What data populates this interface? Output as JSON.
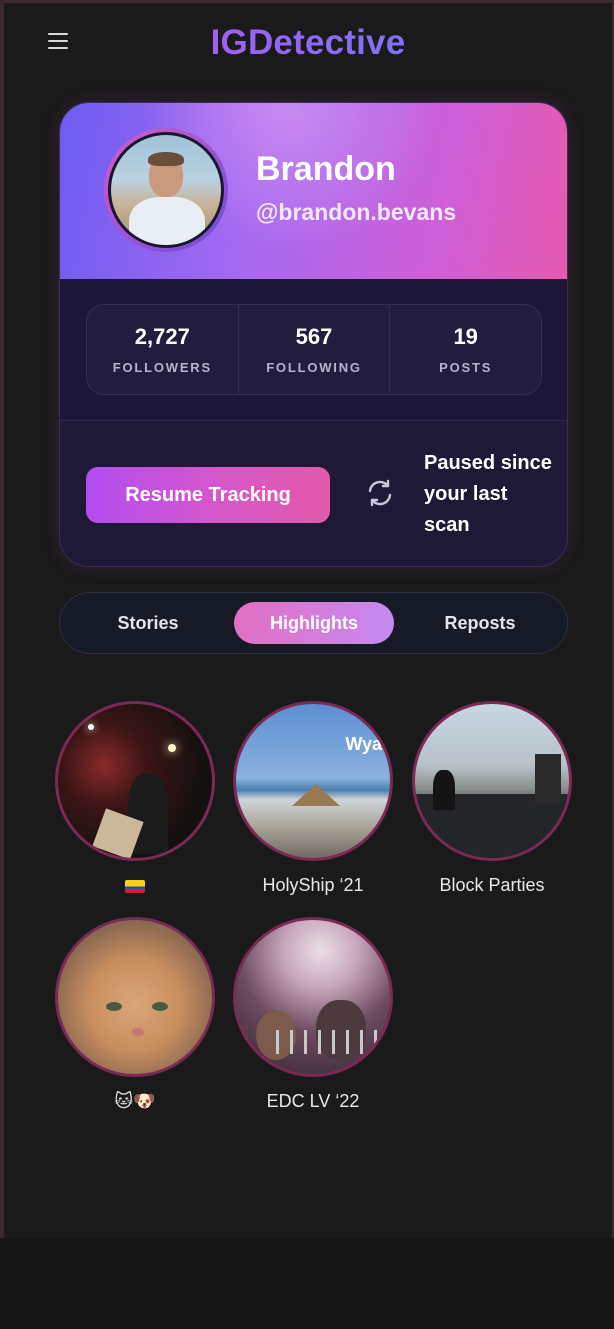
{
  "header": {
    "app_title": "IGDetective",
    "menu_icon": "hamburger-menu-icon"
  },
  "profile": {
    "name": "Brandon",
    "handle": "@brandon.bevans",
    "stats": [
      {
        "value": "2,727",
        "label": "FOLLOWERS"
      },
      {
        "value": "567",
        "label": "FOLLOWING"
      },
      {
        "value": "19",
        "label": "POSTS"
      }
    ],
    "tracking": {
      "button_label": "Resume Tracking",
      "status_icon": "sync-icon",
      "status_text": "Paused since your last scan"
    }
  },
  "tabs": [
    {
      "label": "Stories",
      "active": false
    },
    {
      "label": "Highlights",
      "active": true
    },
    {
      "label": "Reposts",
      "active": false
    }
  ],
  "highlights": [
    {
      "label": "🇨🇴",
      "image_overlay": ""
    },
    {
      "label": "HolyShip ‘21",
      "image_overlay": "Wya"
    },
    {
      "label": "Block Parties",
      "image_overlay": ""
    },
    {
      "label": "🐱🐶",
      "image_overlay": ""
    },
    {
      "label": "EDC LV ‘22",
      "image_overlay": ""
    }
  ],
  "colors": {
    "background": "#1a1a1a",
    "accent_purple": "#b24df2",
    "accent_pink": "#e35aa8",
    "accent_blue": "#5b8ef5"
  }
}
